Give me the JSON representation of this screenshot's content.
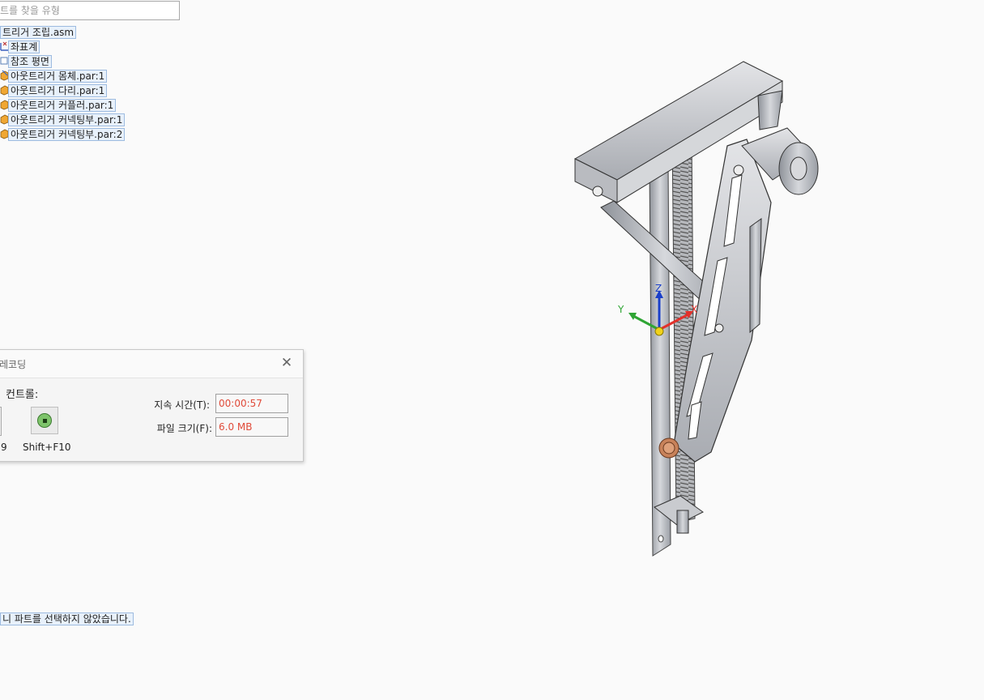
{
  "search": {
    "placeholder": "트를 찾을 유형"
  },
  "tree": {
    "items": [
      {
        "label": "트리거 조립.asm",
        "icon": "none"
      },
      {
        "label": "좌표계",
        "icon": "coordinate-system-icon"
      },
      {
        "label": "참조 평면",
        "icon": "reference-plane-icon"
      },
      {
        "label": "아웃트리거 몸체.par:1",
        "icon": "part-icon"
      },
      {
        "label": "아웃트리거 다리.par:1",
        "icon": "part-icon"
      },
      {
        "label": "아웃트리거 커플러.par:1",
        "icon": "part-icon"
      },
      {
        "label": "아웃트리거 커넥팅부.par:1",
        "icon": "part-icon"
      },
      {
        "label": "아웃트리거 커넥팅부.par:2",
        "icon": "part-icon"
      }
    ]
  },
  "status": {
    "message": "니 파트를 선택하지 않았습니다."
  },
  "recording_dialog": {
    "title": "레코딩",
    "controls_label": "컨트롤:",
    "left_hotkey": "9",
    "stop_hotkey": "Shift+F10",
    "duration_label": "지속 시간(T):",
    "duration_value": "00:00:57",
    "filesize_label": "파일 크기(F):",
    "filesize_value": "6.0 MB",
    "close_icon": "close-icon",
    "stop_icon": "stop-record-icon",
    "value_color": "#e04b3a"
  },
  "viewport": {
    "axes": {
      "x": "X",
      "y": "Y",
      "z": "Z"
    },
    "axis_colors": {
      "x": "#e3312b",
      "y": "#2fa534",
      "z": "#1a3fc9"
    }
  }
}
